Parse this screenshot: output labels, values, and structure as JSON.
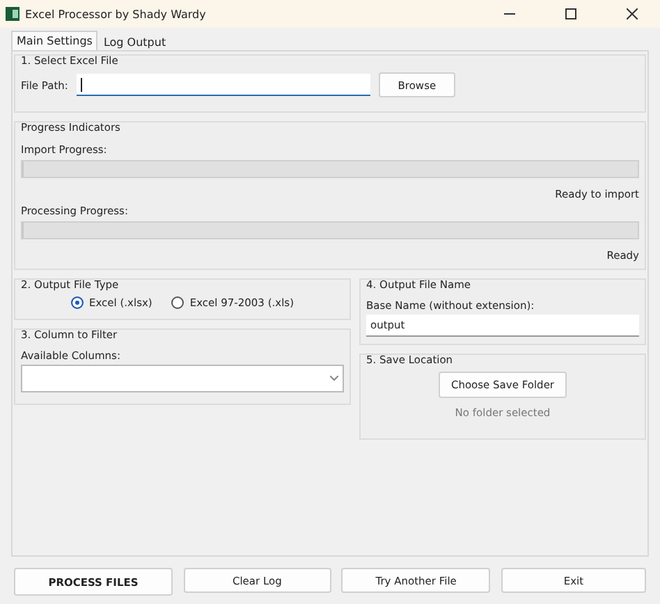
{
  "window": {
    "title": "Excel Processor by Shady Wardy"
  },
  "tabs": [
    {
      "label": "Main Settings",
      "selected": true
    },
    {
      "label": "Log Output",
      "selected": false
    }
  ],
  "select_file": {
    "title": "1. Select Excel File",
    "label": "File Path:",
    "button": "Browse"
  },
  "progress": {
    "title": "Progress Indicators",
    "bars": [
      {
        "label": "Import Progress:",
        "level": 0,
        "status": "Ready to import"
      },
      {
        "label": "Processing Progress:",
        "level": 0,
        "status": "Ready"
      }
    ]
  },
  "output_type": {
    "title": "2. Output File Type",
    "options": [
      {
        "label": "Excel (.xlsx)",
        "selected": true
      },
      {
        "label": "Excel 97-2003 (.xls)",
        "selected": false
      }
    ]
  },
  "column_filter": {
    "title": "3. Column to Filter",
    "label": "Available Columns:"
  },
  "output_name": {
    "title": "4. Output File Name",
    "label": "Base Name (without extension):",
    "value": "output"
  },
  "save_location": {
    "title": "5. Save Location",
    "button": "Choose Save Folder",
    "status": "No folder selected"
  },
  "buttons": [
    {
      "label": "PROCESS FILES",
      "kind": "primary"
    },
    {
      "label": "Clear Log",
      "kind": "normal"
    },
    {
      "label": "Try Another File",
      "kind": "normal"
    },
    {
      "label": "Exit",
      "kind": "normal"
    }
  ]
}
